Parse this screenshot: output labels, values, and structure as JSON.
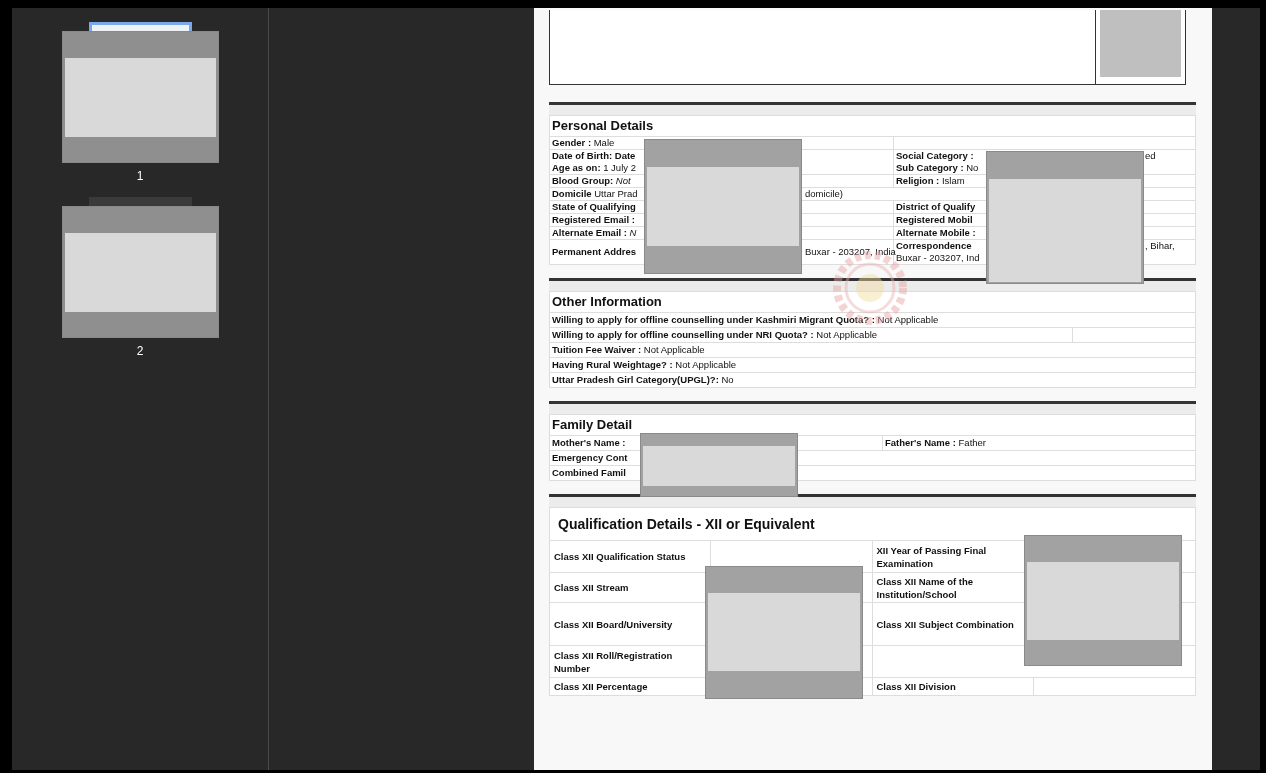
{
  "sidebar": {
    "thumbnails": [
      {
        "page_number": "1",
        "selected": true
      },
      {
        "page_number": "2",
        "selected": false
      }
    ]
  },
  "document": {
    "sections": [
      {
        "title": "Personal Details",
        "rows": [
          {
            "cells": [
              {
                "kind": "text",
                "lines": [
                  [
                    "**Gender :** Male"
                  ]
                ]
              },
              {
                "kind": "blank"
              }
            ]
          },
          {
            "cells": [
              {
                "kind": "text",
                "lines": [
                  [
                    "**Date of Birth: Date**"
                  ],
                  [
                    "**Age as on:** 1 July 2"
                  ]
                ]
              },
              {
                "kind": "text",
                "lines": [
                  [
                    "**Social Category :**",
                    "ed"
                  ],
                  [
                    "**Sub Category :** No"
                  ]
                ]
              }
            ]
          },
          {
            "cells": [
              {
                "kind": "text",
                "lines": [
                  [
                    "**Blood Group:** *Not*"
                  ]
                ]
              },
              {
                "kind": "text",
                "lines": [
                  [
                    "**Religion :** Islam"
                  ]
                ]
              }
            ]
          },
          {
            "cells": [
              {
                "kind": "text",
                "lines": [
                  [
                    "**Domicile** Uttar Prad",
                    "domicile)"
                  ]
                ]
              }
            ]
          },
          {
            "cells": [
              {
                "kind": "text",
                "lines": [
                  [
                    "**State of Qualifying**"
                  ]
                ]
              },
              {
                "kind": "text",
                "lines": [
                  [
                    "**District of Qualify**"
                  ]
                ]
              }
            ]
          },
          {
            "cells": [
              {
                "kind": "text",
                "lines": [
                  [
                    "**Registered Email :**"
                  ]
                ]
              },
              {
                "kind": "text",
                "lines": [
                  [
                    "**Registered Mobil**"
                  ]
                ]
              }
            ]
          },
          {
            "cells": [
              {
                "kind": "text",
                "lines": [
                  [
                    "**Alternate Email :** *N*"
                  ]
                ]
              },
              {
                "kind": "text",
                "lines": [
                  [
                    "**Alternate Mobile :**"
                  ]
                ]
              }
            ]
          },
          {
            "cells": [
              {
                "kind": "text",
                "lines": [
                  [
                    "**Permanent Addres**",
                    "Buxar - 203207, India"
                  ]
                ]
              },
              {
                "kind": "text",
                "lines": [
                  [
                    "**Correspondence**",
                    ", Bihar,"
                  ],
                  [
                    "Buxar - 203207, Ind"
                  ]
                ]
              }
            ]
          }
        ]
      },
      {
        "title": "Other Information",
        "rows": [
          {
            "cells": [
              {
                "kind": "text",
                "lines": [
                  [
                    "**Willing to apply for offline counselling under Kashmiri Migrant Quota? :** Not Applicable"
                  ]
                ]
              }
            ]
          },
          {
            "cells": [
              {
                "kind": "text",
                "lines": [
                  [
                    "**Willing to apply for offline counselling under NRI Quota? :** Not Applicable"
                  ]
                ]
              },
              {
                "kind": "blank"
              }
            ]
          },
          {
            "cells": [
              {
                "kind": "text",
                "lines": [
                  [
                    "**Tuition Fee Waiver :** Not Applicable"
                  ]
                ]
              }
            ]
          },
          {
            "cells": [
              {
                "kind": "text",
                "lines": [
                  [
                    "**Having Rural Weightage? :** Not Applicable"
                  ]
                ]
              }
            ]
          },
          {
            "cells": [
              {
                "kind": "text",
                "lines": [
                  [
                    "**Uttar Pradesh Girl Category(UPGL)?:** No"
                  ]
                ]
              }
            ]
          }
        ]
      },
      {
        "title": "Family Detail",
        "rows": [
          {
            "cells": [
              {
                "kind": "text",
                "lines": [
                  [
                    "**Mother's Name :**"
                  ]
                ]
              },
              {
                "kind": "text",
                "lines": [
                  [
                    "**Father's Name :** Father"
                  ]
                ]
              }
            ]
          },
          {
            "cells": [
              {
                "kind": "text",
                "lines": [
                  [
                    "**Emergency Cont**"
                  ]
                ]
              }
            ]
          },
          {
            "cells": [
              {
                "kind": "text",
                "lines": [
                  [
                    "**Combined Famil**"
                  ]
                ]
              }
            ]
          }
        ]
      },
      {
        "title": "Qualification Details - XII or Equivalent",
        "rows": [
          {
            "cells": [
              {
                "kind": "label",
                "text": "Class XII Qualification Status"
              },
              {
                "kind": "blank"
              },
              {
                "kind": "label",
                "text": "XII Year of Passing Final Examination"
              },
              {
                "kind": "blank"
              }
            ]
          },
          {
            "cells": [
              {
                "kind": "label",
                "text": "Class XII Stream"
              },
              {
                "kind": "blank"
              },
              {
                "kind": "label",
                "text": "Class XII Name of the Institution/School"
              },
              {
                "kind": "blank"
              }
            ]
          },
          {
            "cells": [
              {
                "kind": "label",
                "text": "Class XII Board/University"
              },
              {
                "kind": "blank"
              },
              {
                "kind": "label",
                "text": "Class XII Subject Combination"
              },
              {
                "kind": "blank"
              }
            ]
          },
          {
            "cells": [
              {
                "kind": "label",
                "text": "Class XII Roll/Registration Number"
              },
              {
                "kind": "blank"
              },
              {
                "kind": "blank"
              }
            ]
          },
          {
            "cells": [
              {
                "kind": "label",
                "text": "Class XII Percentage"
              },
              {
                "kind": "blank"
              },
              {
                "kind": "label",
                "text": "Class XII Division"
              },
              {
                "kind": "blank"
              }
            ]
          }
        ]
      }
    ]
  }
}
